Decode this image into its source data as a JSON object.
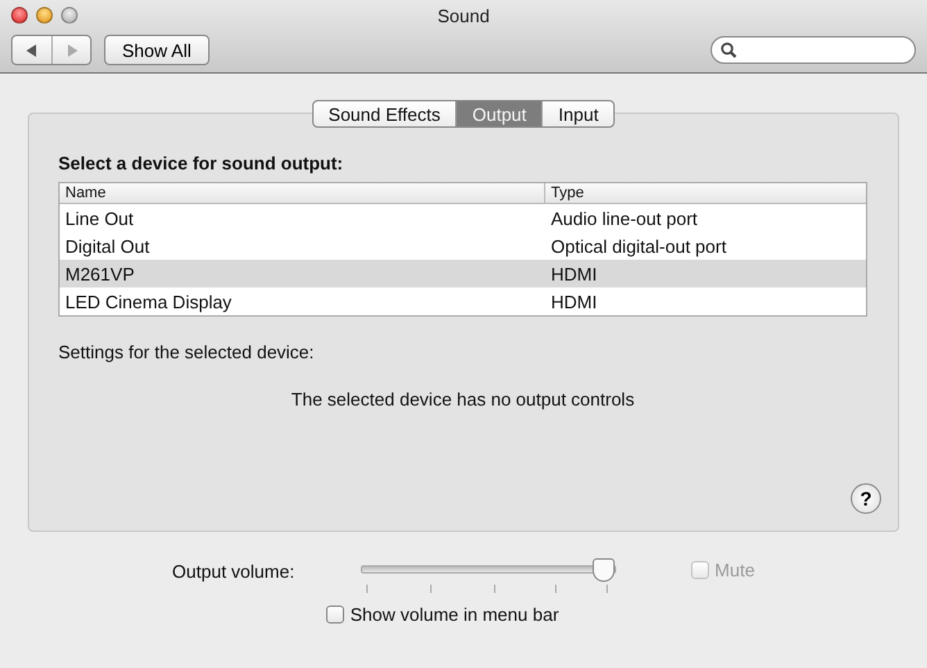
{
  "window": {
    "title": "Sound"
  },
  "toolbar": {
    "show_all": "Show All"
  },
  "tabs": [
    {
      "label": "Sound Effects",
      "selected": false
    },
    {
      "label": "Output",
      "selected": true
    },
    {
      "label": "Input",
      "selected": false
    }
  ],
  "device_heading": "Select a device for sound output:",
  "table": {
    "columns": [
      "Name",
      "Type"
    ],
    "rows": [
      {
        "cells": [
          "Line Out",
          "Audio line-out port"
        ],
        "selected": false
      },
      {
        "cells": [
          "Digital Out",
          "Optical digital-out port"
        ],
        "selected": false
      },
      {
        "cells": [
          "M261VP",
          "HDMI"
        ],
        "selected": true
      },
      {
        "cells": [
          "LED Cinema Display",
          "HDMI"
        ],
        "selected": false
      }
    ]
  },
  "settings_label": "Settings for the selected device:",
  "no_controls_message": "The selected device has no output controls",
  "help_button": "?",
  "volume": {
    "label": "Output volume:",
    "level": 0.95,
    "mute": {
      "label": "Mute",
      "checked": false,
      "disabled": true
    }
  },
  "show_in_menu_bar": {
    "label": "Show volume in menu bar",
    "checked": false,
    "disabled": false
  }
}
